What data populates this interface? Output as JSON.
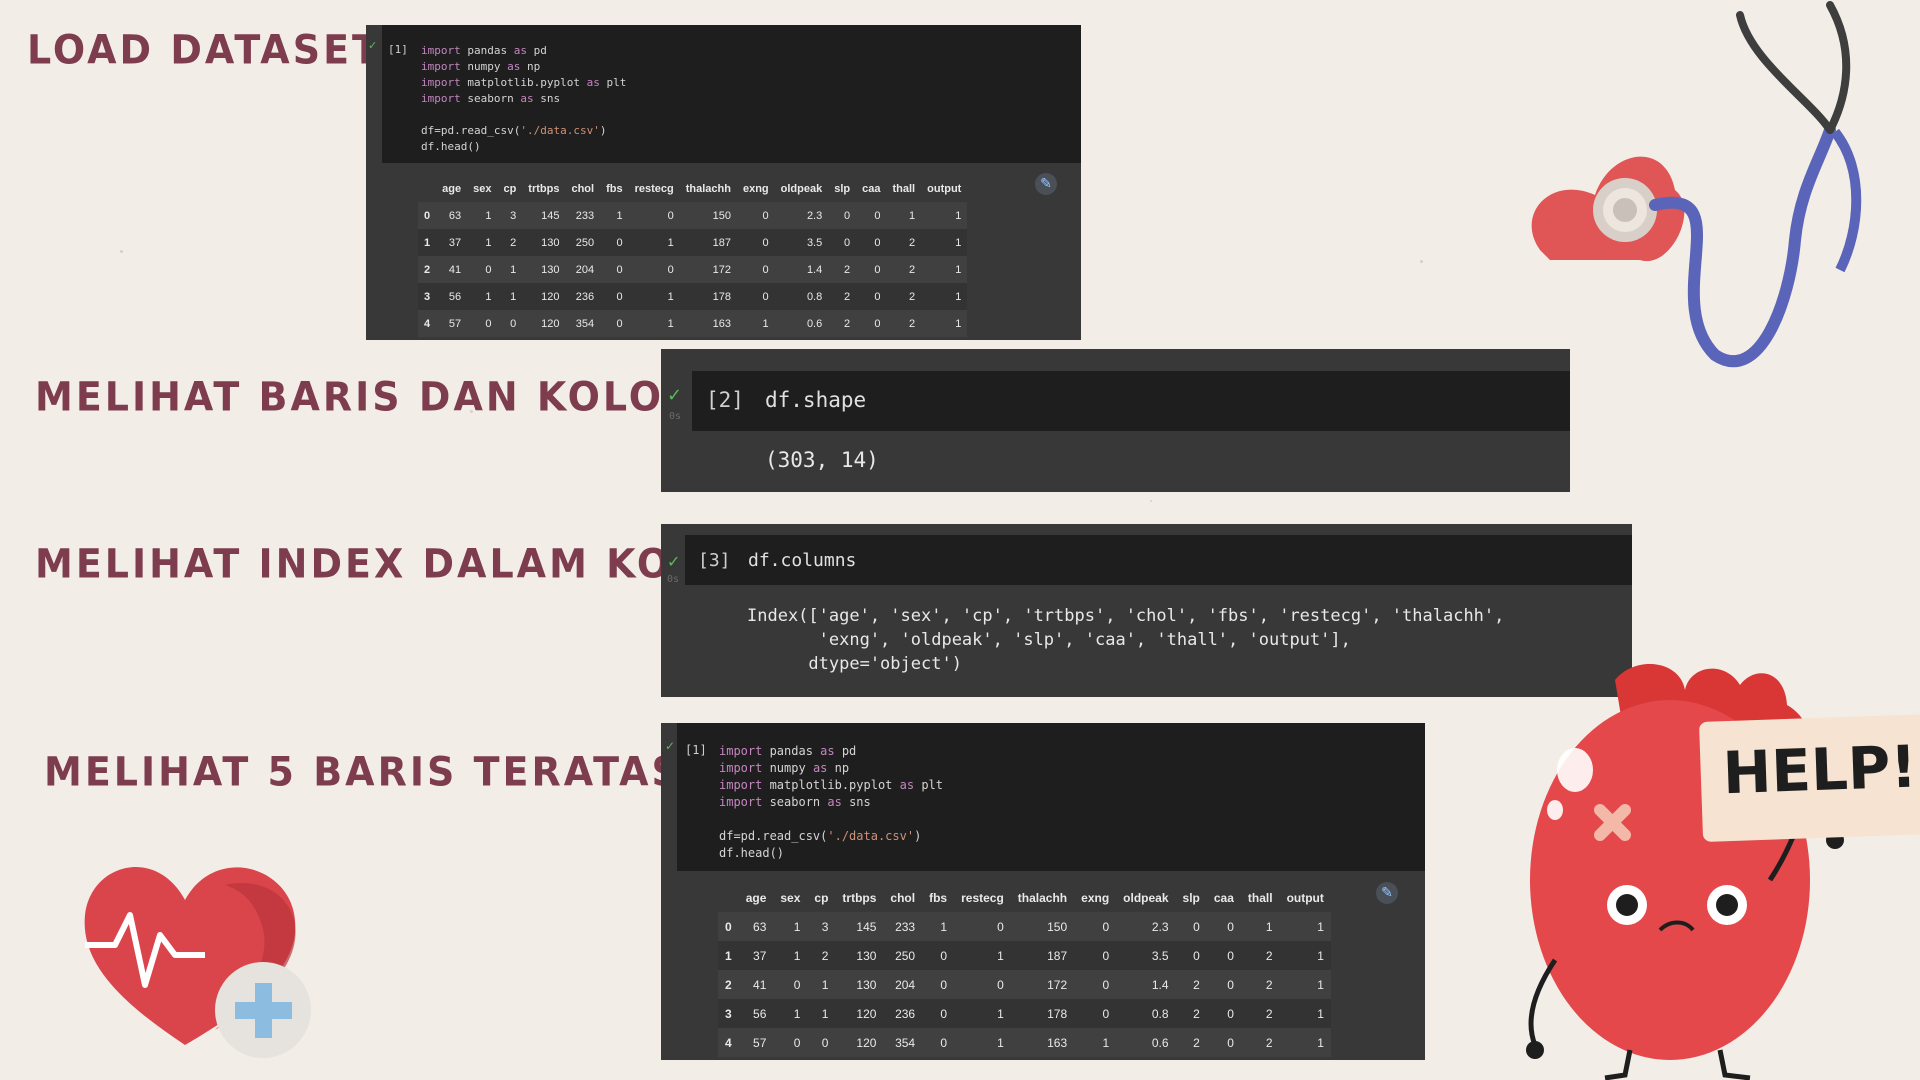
{
  "headings": {
    "load": "LOAD DATASET",
    "shape": "MELIHAT BARIS DAN KOLOM",
    "index": "MELIHAT INDEX DALAM KOLOM",
    "head": "MELIHAT 5 BARIS TERATAS"
  },
  "cell1": {
    "number": "[1]",
    "lines": [
      {
        "kw": "import",
        "rest": " pandas ",
        "kw2": "as",
        "rest2": " pd"
      },
      {
        "kw": "import",
        "rest": " numpy ",
        "kw2": "as",
        "rest2": " np"
      },
      {
        "kw": "import",
        "rest": " matplotlib.pyplot ",
        "kw2": "as",
        "rest2": " plt"
      },
      {
        "kw": "import",
        "rest": " seaborn ",
        "kw2": "as",
        "rest2": " sns"
      }
    ],
    "read_prefix": "df=pd.read_csv(",
    "read_arg": "'./data.csv'",
    "read_suffix": ")",
    "head_call": "df.head()"
  },
  "cell2": {
    "number": "[2]",
    "code": "df.shape",
    "exec_time": "0s",
    "output": "(303, 14)"
  },
  "cell3": {
    "number": "[3]",
    "code": "df.columns",
    "exec_time": "0s",
    "output_lines": [
      "Index(['age', 'sex', 'cp', 'trtbps', 'chol', 'fbs', 'restecg', 'thalachh',",
      "       'exng', 'oldpeak', 'slp', 'caa', 'thall', 'output'],",
      "      dtype='object')"
    ]
  },
  "dataframe": {
    "columns": [
      "",
      "age",
      "sex",
      "cp",
      "trtbps",
      "chol",
      "fbs",
      "restecg",
      "thalachh",
      "exng",
      "oldpeak",
      "slp",
      "caa",
      "thall",
      "output"
    ],
    "rows": [
      [
        "0",
        "63",
        "1",
        "3",
        "145",
        "233",
        "1",
        "0",
        "150",
        "0",
        "2.3",
        "0",
        "0",
        "1",
        "1"
      ],
      [
        "1",
        "37",
        "1",
        "2",
        "130",
        "250",
        "0",
        "1",
        "187",
        "0",
        "3.5",
        "0",
        "0",
        "2",
        "1"
      ],
      [
        "2",
        "41",
        "0",
        "1",
        "130",
        "204",
        "0",
        "0",
        "172",
        "0",
        "1.4",
        "2",
        "0",
        "2",
        "1"
      ],
      [
        "3",
        "56",
        "1",
        "1",
        "120",
        "236",
        "0",
        "1",
        "178",
        "0",
        "0.8",
        "2",
        "0",
        "2",
        "1"
      ],
      [
        "4",
        "57",
        "0",
        "0",
        "120",
        "354",
        "0",
        "1",
        "163",
        "1",
        "0.6",
        "2",
        "0",
        "2",
        "1"
      ]
    ]
  },
  "decor": {
    "help_sign": "HELP!",
    "check_icon": "check-icon",
    "magic_icon": "magic-wand-icon",
    "colors": {
      "heading": "#7d3d4f",
      "heart": "#e04848",
      "panel": "#383838"
    }
  }
}
